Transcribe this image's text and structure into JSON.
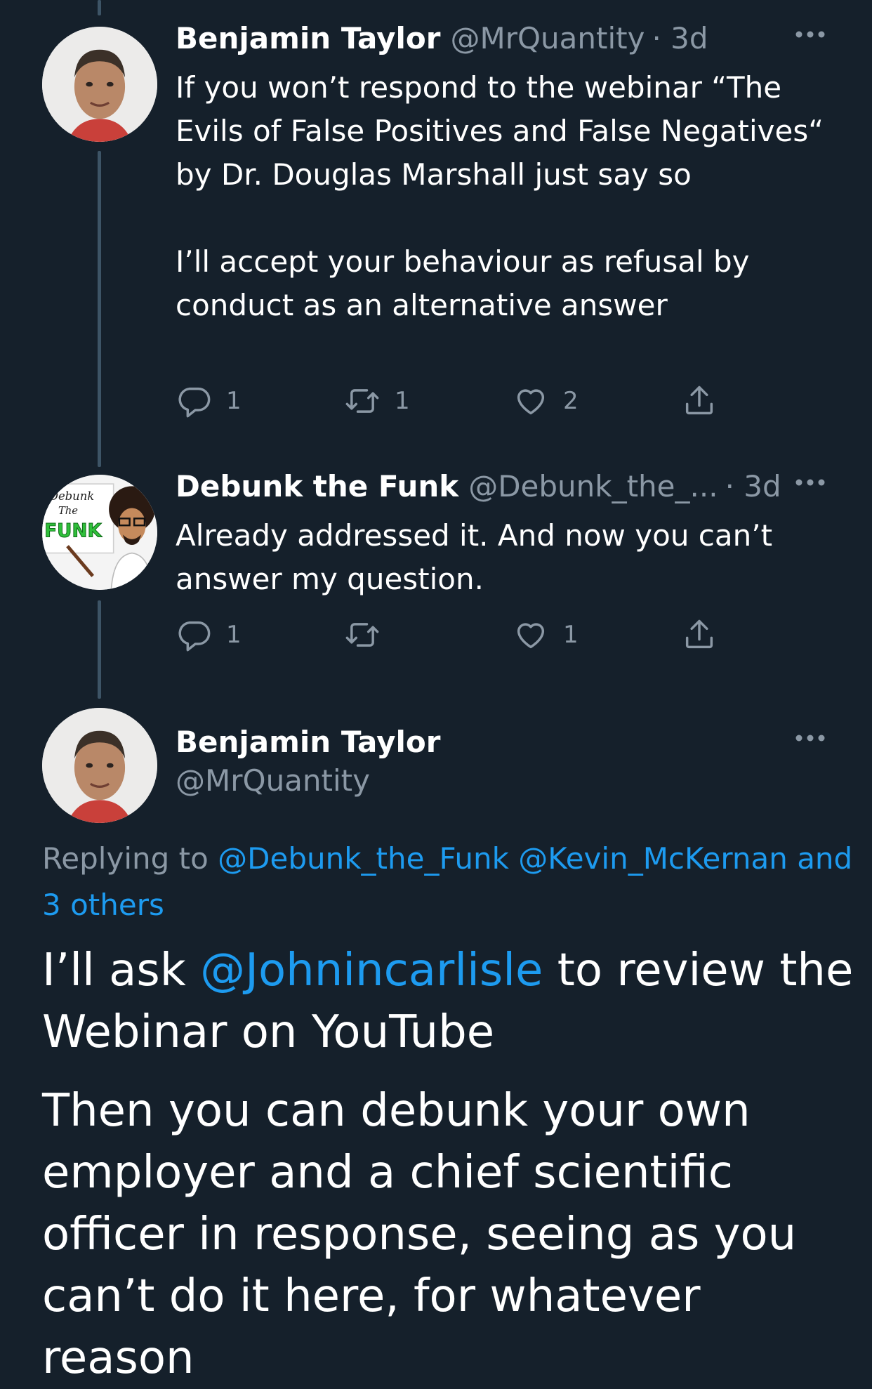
{
  "tweets": [
    {
      "name": "Benjamin Taylor",
      "handle": "@MrQuantity",
      "time": "· 3d",
      "text1": "If you won’t respond to the webinar “The Evils of False Positives and False Negatives“ by Dr. Douglas Marshall just say so",
      "text2": "I’ll accept your behaviour as refusal by conduct as an alternative answer",
      "reply_count": "1",
      "retweet_count": "1",
      "like_count": "2"
    },
    {
      "name": "Debunk the Funk",
      "handle": "@Debunk_the_...",
      "time": "· 3d",
      "text1": "Already addressed it. And now you can’t answer my question.",
      "reply_count": "1",
      "retweet_count": "",
      "like_count": "1",
      "avatar_text": [
        "Debunk",
        "The",
        "FUNK"
      ]
    }
  ],
  "main_tweet": {
    "name": "Benjamin Taylor",
    "handle": "@MrQuantity",
    "replying_prefix": "Replying to",
    "replying_to_1": "@Debunk_the_Funk",
    "replying_to_2": "@Kevin_McKernan",
    "replying_others": "and 3 others",
    "p1_a": "I’ll ask",
    "p1_mention": "@Johnincarlisle",
    "p1_b": "to review the Webinar on YouTube",
    "p2": "Then you can debunk your own employer and a chief scientific officer in response, seeing as you can’t do it here, for whatever reason"
  },
  "icons": {
    "reply": "reply-icon",
    "retweet": "retweet-icon",
    "like": "heart-icon",
    "share": "share-icon",
    "more": "more-icon"
  },
  "colors": {
    "background": "#15202b",
    "text": "#ffffff",
    "muted": "#8b98a5",
    "link": "#1d9bf0",
    "thread_line": "#3d5466"
  }
}
